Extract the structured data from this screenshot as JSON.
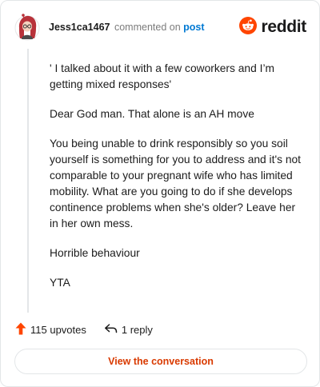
{
  "header": {
    "username": "Jess1ca1467",
    "action_text": "commented on",
    "post_link_text": "post",
    "brand_text": "reddit"
  },
  "comment": {
    "paragraphs": [
      "' I talked about it with a few coworkers and I’m getting mixed responses'",
      "Dear God man. That alone is an AH move",
      "You being unable to drink responsibly so you soil yourself is something for you to address and it's not comparable to your pregnant wife who has limited mobility. What are you going to do if she develops continence problems when she's older? Leave her in her own mess.",
      "Horrible behaviour",
      "YTA"
    ]
  },
  "actions": {
    "upvotes_label": "115 upvotes",
    "replies_label": "1 reply"
  },
  "cta": {
    "label": "View the conversation"
  },
  "colors": {
    "brand": "#ff4500",
    "link": "#0079d3",
    "cta_text": "#d93a00",
    "upvote": "#ff4500"
  },
  "icons": {
    "avatar": "user-avatar",
    "brand": "reddit-logo-icon",
    "upvote": "upvote-arrow-icon",
    "reply": "reply-arrow-icon"
  }
}
